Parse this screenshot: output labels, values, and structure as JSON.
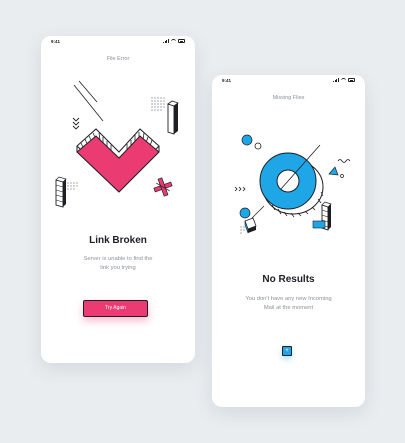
{
  "screen_a": {
    "status": {
      "time": "9:41"
    },
    "title": "File Error",
    "heading": "Link Broken",
    "description_line1": "Server is unable to find the",
    "description_line2": "link you trying",
    "button_label": "Try Again",
    "colors": {
      "accent": "#ea3b72",
      "outline": "#1d1f24"
    }
  },
  "screen_b": {
    "status": {
      "time": "9:41"
    },
    "title": "Missing Flies",
    "heading": "No Results",
    "description_line1": "You don't have any new Incoming",
    "description_line2": "Mail at the moment",
    "button_icon": "plus-icon",
    "colors": {
      "accent": "#1ea6e6",
      "outline": "#1d1f24"
    }
  }
}
